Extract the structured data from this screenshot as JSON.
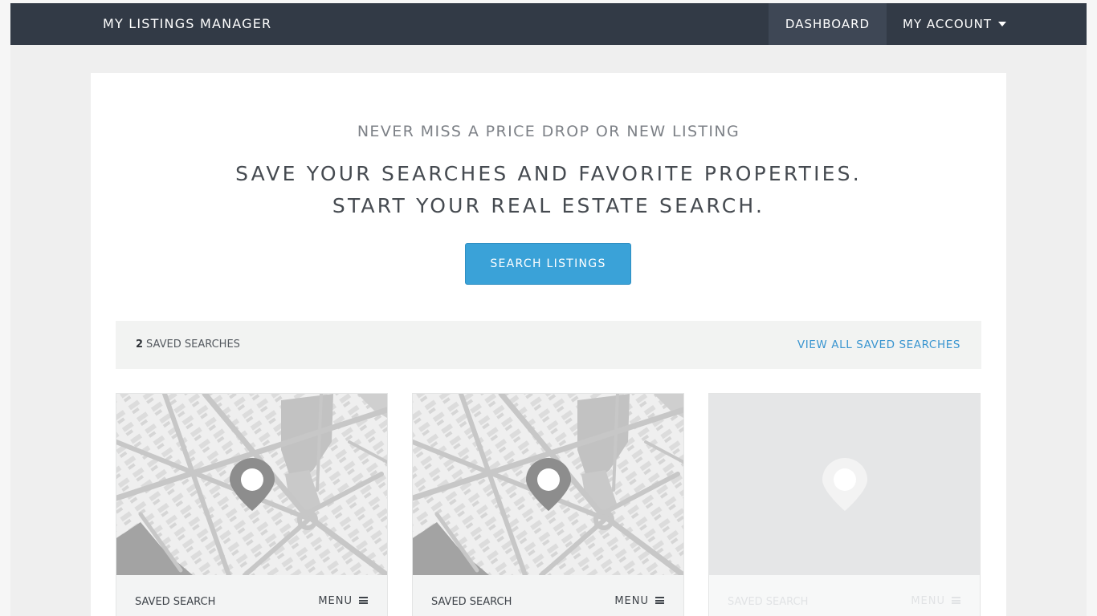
{
  "header": {
    "brand": "MY LISTINGS MANAGER",
    "nav": {
      "dashboard": "DASHBOARD",
      "account": "MY ACCOUNT"
    }
  },
  "hero": {
    "tagline": "NEVER MISS A PRICE DROP OR NEW LISTING",
    "headline_line1": "SAVE YOUR SEARCHES AND FAVORITE PROPERTIES.",
    "headline_line2": "START YOUR REAL ESTATE SEARCH.",
    "cta": "SEARCH LISTINGS"
  },
  "saved": {
    "count": "2",
    "count_suffix": "SAVED SEARCHES",
    "view_all": "VIEW ALL SAVED SEARCHES",
    "tiles": [
      {
        "label": "SAVED SEARCH",
        "menu": "MENU",
        "icon": "map-pin-icon"
      },
      {
        "label": "SAVED SEARCH",
        "menu": "MENU",
        "icon": "map-pin-icon"
      },
      {
        "label": "SAVED SEARCH",
        "menu": "MENU",
        "icon": "map-pin-icon"
      }
    ]
  },
  "colors": {
    "navbar": "#323a46",
    "nav_active": "#3e4755",
    "accent": "#3aa2d8",
    "link": "#3a95d0",
    "page_bg": "#efefef"
  }
}
